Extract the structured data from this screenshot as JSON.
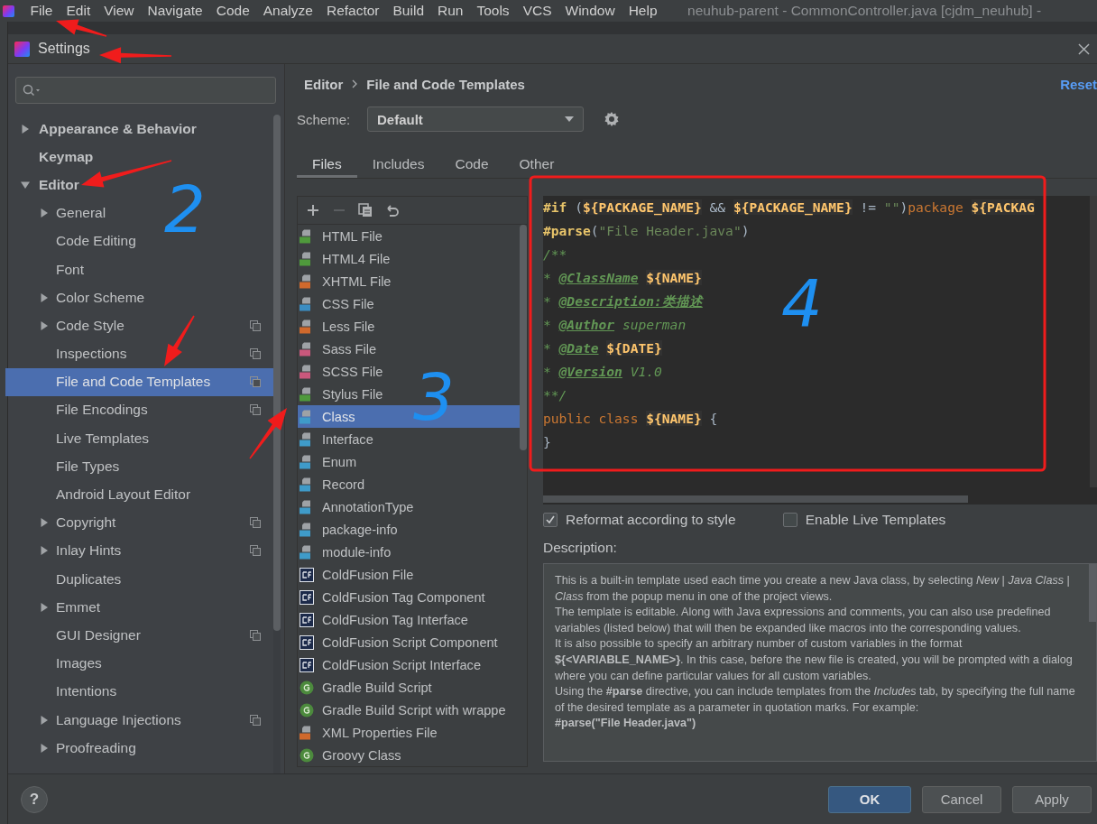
{
  "menu_bar": {
    "items": [
      "File",
      "Edit",
      "View",
      "Navigate",
      "Code",
      "Analyze",
      "Refactor",
      "Build",
      "Run",
      "Tools",
      "VCS",
      "Window",
      "Help"
    ],
    "window_title": "neuhub-parent - CommonController.java [cjdm_neuhub] -"
  },
  "dialog": {
    "title": "Settings"
  },
  "sidebar": {
    "items": [
      {
        "label": "Appearance & Behavior",
        "kind": "group",
        "expanded": false,
        "selected": false,
        "project_level": false
      },
      {
        "label": "Keymap",
        "kind": "leaf",
        "selected": false,
        "project_level": false
      },
      {
        "label": "Editor",
        "kind": "group",
        "expanded": true,
        "selected": false,
        "project_level": false,
        "children": [
          {
            "label": "General",
            "kind": "group",
            "expanded": false,
            "selected": false,
            "project_level": false
          },
          {
            "label": "Code Editing",
            "kind": "leaf",
            "selected": false,
            "project_level": false
          },
          {
            "label": "Font",
            "kind": "leaf",
            "selected": false,
            "project_level": false
          },
          {
            "label": "Color Scheme",
            "kind": "group",
            "expanded": false,
            "selected": false,
            "project_level": false
          },
          {
            "label": "Code Style",
            "kind": "group",
            "expanded": false,
            "selected": false,
            "project_level": true
          },
          {
            "label": "Inspections",
            "kind": "leaf",
            "selected": false,
            "project_level": true
          },
          {
            "label": "File and Code Templates",
            "kind": "leaf",
            "selected": true,
            "project_level": true
          },
          {
            "label": "File Encodings",
            "kind": "leaf",
            "selected": false,
            "project_level": true
          },
          {
            "label": "Live Templates",
            "kind": "leaf",
            "selected": false,
            "project_level": false
          },
          {
            "label": "File Types",
            "kind": "leaf",
            "selected": false,
            "project_level": false
          },
          {
            "label": "Android Layout Editor",
            "kind": "leaf",
            "selected": false,
            "project_level": false
          },
          {
            "label": "Copyright",
            "kind": "group",
            "expanded": false,
            "selected": false,
            "project_level": true
          },
          {
            "label": "Inlay Hints",
            "kind": "group",
            "expanded": false,
            "selected": false,
            "project_level": true
          },
          {
            "label": "Duplicates",
            "kind": "leaf",
            "selected": false,
            "project_level": false
          },
          {
            "label": "Emmet",
            "kind": "group",
            "expanded": false,
            "selected": false,
            "project_level": false
          },
          {
            "label": "GUI Designer",
            "kind": "leaf",
            "selected": false,
            "project_level": true
          },
          {
            "label": "Images",
            "kind": "leaf",
            "selected": false,
            "project_level": false
          },
          {
            "label": "Intentions",
            "kind": "leaf",
            "selected": false,
            "project_level": false
          },
          {
            "label": "Language Injections",
            "kind": "group",
            "expanded": false,
            "selected": false,
            "project_level": true
          },
          {
            "label": "Proofreading",
            "kind": "group",
            "expanded": false,
            "selected": false,
            "project_level": false
          }
        ]
      }
    ]
  },
  "panel": {
    "breadcrumb": [
      "Editor",
      "File and Code Templates"
    ],
    "reset_link": "Reset",
    "scheme": {
      "label": "Scheme:",
      "value": "Default"
    },
    "tabs": [
      {
        "label": "Files",
        "selected": true
      },
      {
        "label": "Includes",
        "selected": false
      },
      {
        "label": "Code",
        "selected": false
      },
      {
        "label": "Other",
        "selected": false
      }
    ],
    "toolbar": [
      {
        "kind": "add",
        "disabled": false
      },
      {
        "kind": "remove",
        "disabled": true
      },
      {
        "kind": "copy",
        "disabled": false
      },
      {
        "kind": "reset",
        "disabled": false
      }
    ],
    "templates": [
      {
        "label": "HTML File",
        "kind": "html",
        "selected": false
      },
      {
        "label": "HTML4 File",
        "kind": "html",
        "selected": false
      },
      {
        "label": "XHTML File",
        "kind": "xhtml",
        "selected": false
      },
      {
        "label": "CSS File",
        "kind": "css",
        "selected": false
      },
      {
        "label": "Less File",
        "kind": "less",
        "selected": false
      },
      {
        "label": "Sass File",
        "kind": "sass",
        "selected": false
      },
      {
        "label": "SCSS File",
        "kind": "sass",
        "selected": false
      },
      {
        "label": "Stylus File",
        "kind": "styl",
        "selected": false
      },
      {
        "label": "Class",
        "kind": "java",
        "selected": true
      },
      {
        "label": "Interface",
        "kind": "java",
        "selected": false
      },
      {
        "label": "Enum",
        "kind": "java",
        "selected": false
      },
      {
        "label": "Record",
        "kind": "java",
        "selected": false
      },
      {
        "label": "AnnotationType",
        "kind": "java",
        "selected": false
      },
      {
        "label": "package-info",
        "kind": "java",
        "selected": false
      },
      {
        "label": "module-info",
        "kind": "java",
        "selected": false
      },
      {
        "label": "ColdFusion File",
        "kind": "cf",
        "selected": false
      },
      {
        "label": "ColdFusion Tag Component",
        "kind": "cf",
        "selected": false
      },
      {
        "label": "ColdFusion Tag Interface",
        "kind": "cf",
        "selected": false
      },
      {
        "label": "ColdFusion Script Component",
        "kind": "cf",
        "selected": false
      },
      {
        "label": "ColdFusion Script Interface",
        "kind": "cf",
        "selected": false
      },
      {
        "label": "Gradle Build Script",
        "kind": "gradle",
        "selected": false
      },
      {
        "label": "Gradle Build Script with wrappe",
        "kind": "gradle",
        "selected": false
      },
      {
        "label": "XML Properties File",
        "kind": "xml",
        "selected": false
      },
      {
        "label": "Groovy Class",
        "kind": "gradle",
        "selected": false
      }
    ],
    "code_lines": [
      [
        {
          "text": "#if",
          "kind": "directive"
        },
        {
          "text": " (",
          "kind": "plain"
        },
        {
          "text": "${PACKAGE_NAME}",
          "kind": "var"
        },
        {
          "text": " && ",
          "kind": "plain"
        },
        {
          "text": "${PACKAGE_NAME}",
          "kind": "var"
        },
        {
          "text": " != ",
          "kind": "plain"
        },
        {
          "text": "\"\"",
          "kind": "string"
        },
        {
          "text": ")",
          "kind": "plain"
        },
        {
          "text": "package",
          "kind": "keyword"
        },
        {
          "text": "${PACKAG",
          "kind": "var",
          "space_before": true
        }
      ],
      [
        {
          "text": "#parse",
          "kind": "directive"
        },
        {
          "text": "(",
          "kind": "plain"
        },
        {
          "text": "\"File Header.java\"",
          "kind": "string"
        },
        {
          "text": ")",
          "kind": "plain"
        }
      ],
      [
        {
          "text": "/**",
          "kind": "comment"
        }
      ],
      [
        {
          "text": "* ",
          "kind": "comment"
        },
        {
          "text": "@ClassName",
          "kind": "doctag"
        },
        {
          "text": "${NAME}",
          "kind": "var",
          "space_before": true
        }
      ],
      [
        {
          "text": "* ",
          "kind": "comment"
        },
        {
          "text": "@Description:类描述",
          "kind": "doctag"
        }
      ],
      [
        {
          "text": "* ",
          "kind": "comment"
        },
        {
          "text": "@Author",
          "kind": "doctag"
        },
        {
          "text": " superman",
          "kind": "comment"
        }
      ],
      [
        {
          "text": "* ",
          "kind": "comment"
        },
        {
          "text": "@Date",
          "kind": "doctag"
        },
        {
          "text": "${DATE}",
          "kind": "var",
          "space_before": true
        }
      ],
      [
        {
          "text": "* ",
          "kind": "comment"
        },
        {
          "text": "@Version",
          "kind": "doctag"
        },
        {
          "text": " V1.0",
          "kind": "comment"
        }
      ],
      [
        {
          "text": "**/",
          "kind": "comment"
        }
      ],
      [
        {
          "text": "public class",
          "kind": "keyword"
        },
        {
          "text": "${NAME}",
          "kind": "var",
          "space_before": true
        },
        {
          "text": " {",
          "kind": "plain"
        }
      ],
      [
        {
          "text": "}",
          "kind": "plain"
        }
      ]
    ],
    "options": [
      {
        "label": "Reformat according to style",
        "checked": true
      },
      {
        "label": "Enable Live Templates",
        "checked": false
      }
    ],
    "description": {
      "label": "Description:",
      "paragraphs": [
        "This is a built-in template used each time you create a new Java class, by selecting *New* | *Java Class* | *Class* from the popup menu in one of the project views.",
        "The template is editable. Along with Java expressions and comments, you can also use predefined variables (listed below) that will then be expanded like macros into the corresponding values.",
        "It is also possible to specify an arbitrary number of custom variables in the format **${<VARIABLE_NAME>}**. In this case, before the new file is created, you will be prompted with a dialog where you can define particular values for all custom variables.",
        "Using the **#parse** directive, you can include templates from the *Includes* tab, by specifying the full name of the desired template as a parameter in quotation marks. For example:"
      ],
      "example": "#parse(\"File Header.java\")"
    }
  },
  "footer": {
    "help": "?",
    "buttons": [
      {
        "label": "OK",
        "default": true
      },
      {
        "label": "Cancel",
        "default": false
      },
      {
        "label": "Apply",
        "default": false
      }
    ]
  },
  "annotations": {
    "numbers": [
      "2",
      "3",
      "4"
    ]
  }
}
